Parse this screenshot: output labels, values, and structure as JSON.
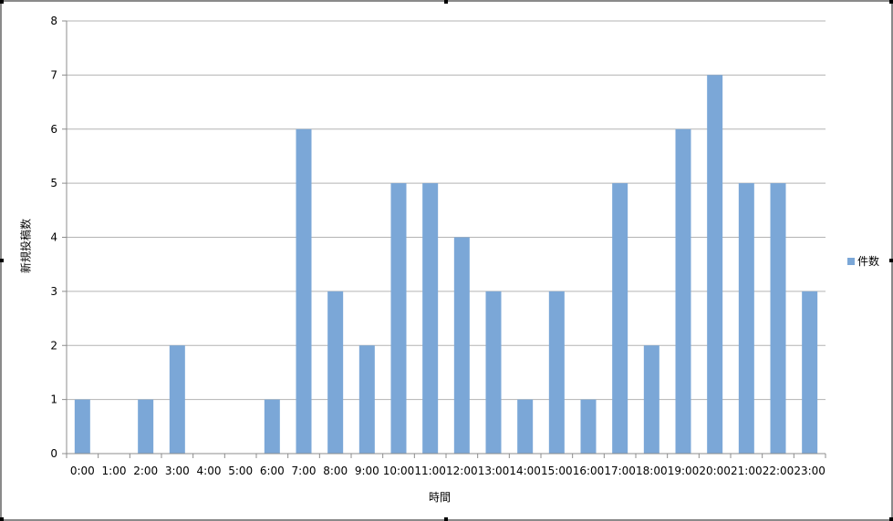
{
  "colors": {
    "bar": "#7ba7d7",
    "grid": "#b3b3b3",
    "axis": "#8c8c8c"
  },
  "chart_data": {
    "type": "bar",
    "categories": [
      "0:00",
      "1:00",
      "2:00",
      "3:00",
      "4:00",
      "5:00",
      "6:00",
      "7:00",
      "8:00",
      "9:00",
      "10:00",
      "11:00",
      "12:00",
      "13:00",
      "14:00",
      "15:00",
      "16:00",
      "17:00",
      "18:00",
      "19:00",
      "20:00",
      "21:00",
      "22:00",
      "23:00"
    ],
    "series": [
      {
        "name": "件数",
        "values": [
          1,
          0,
          1,
          2,
          0,
          0,
          1,
          6,
          3,
          2,
          5,
          5,
          4,
          3,
          1,
          3,
          1,
          5,
          2,
          6,
          7,
          5,
          5,
          3
        ]
      }
    ],
    "xlabel": "時間",
    "ylabel": "新規投稿数",
    "ylim": [
      0,
      8
    ],
    "yticks": [
      0,
      1,
      2,
      3,
      4,
      5,
      6,
      7,
      8
    ],
    "grid": true,
    "legend_position": "right"
  }
}
